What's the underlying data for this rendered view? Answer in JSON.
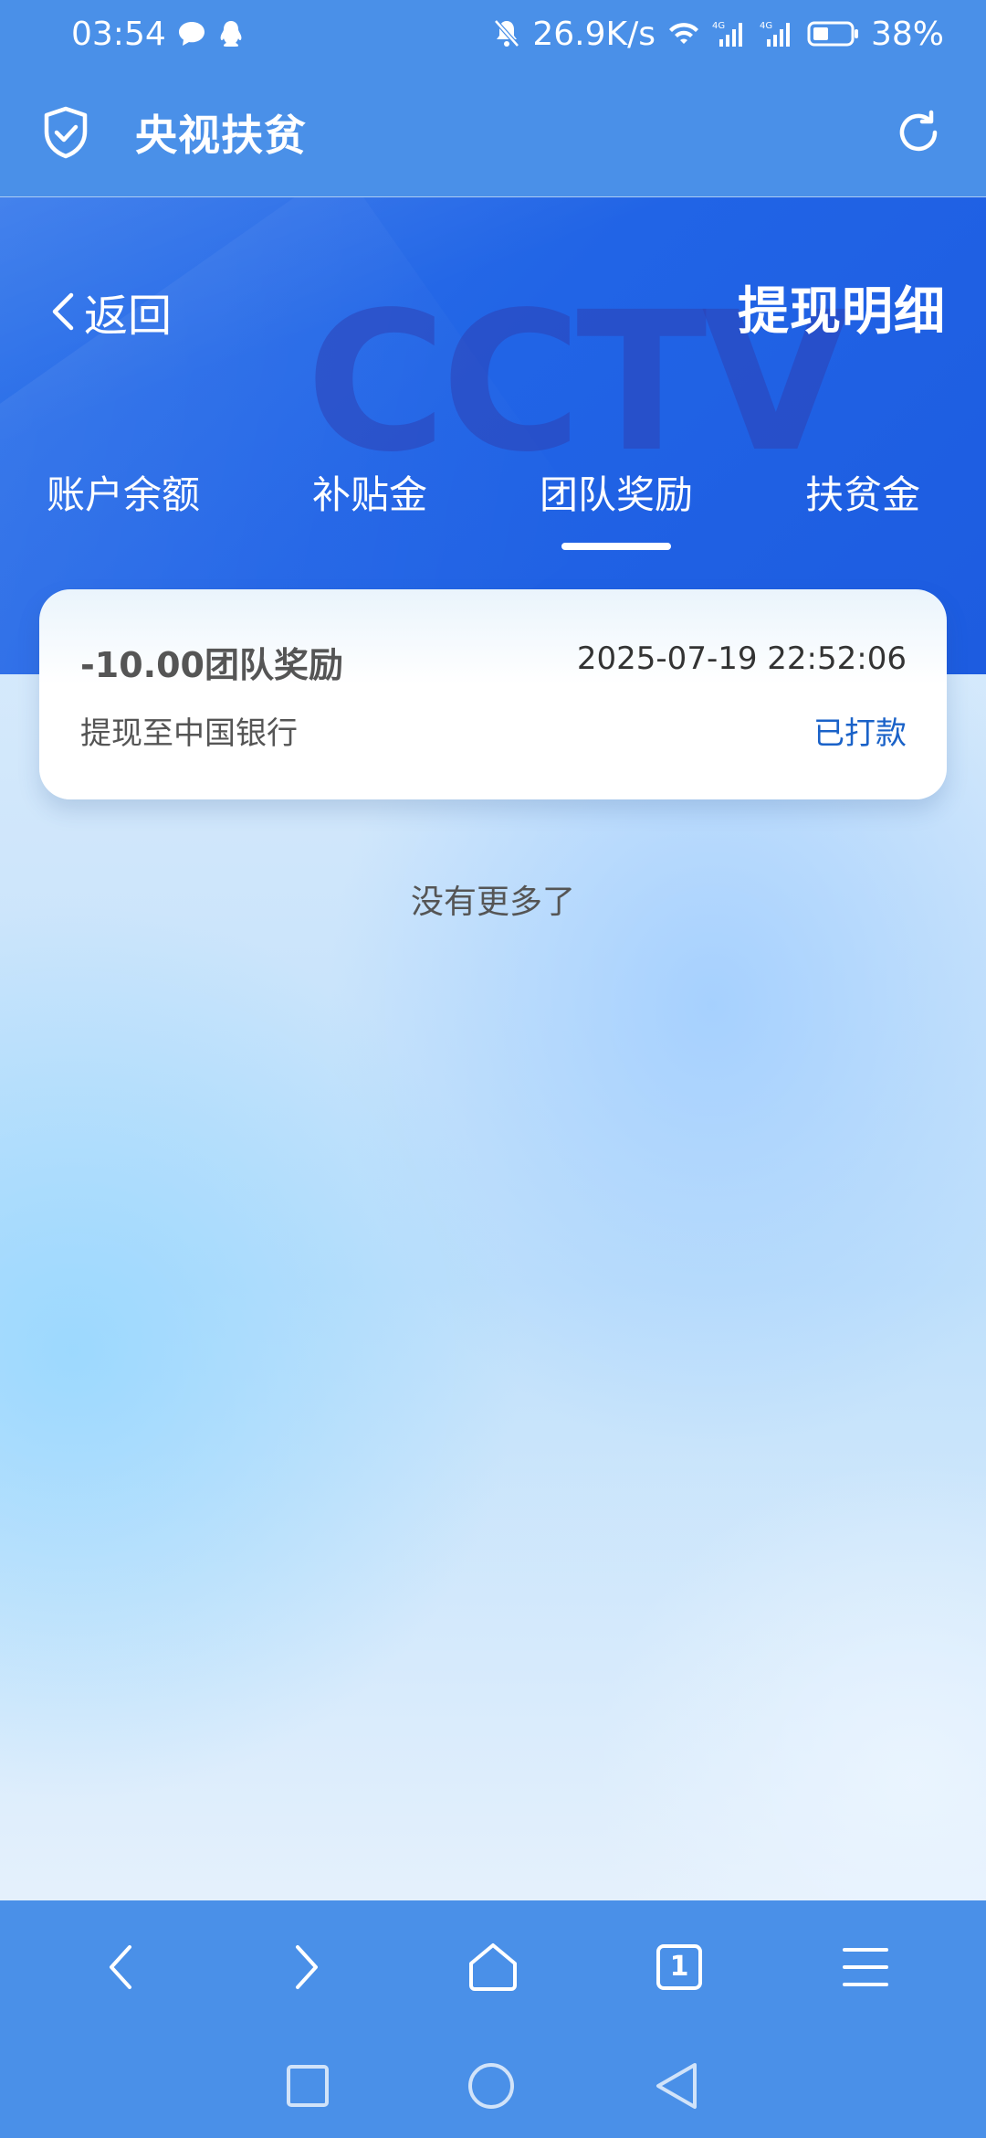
{
  "status_bar": {
    "time": "03:54",
    "network_speed": "26.9K/s",
    "signal1": "4G",
    "signal2": "4G",
    "battery": "38%"
  },
  "app_header": {
    "title": "央视扶贫"
  },
  "hero": {
    "back_label": "返回",
    "page_title": "提现明细",
    "logo_text": "CCTV",
    "tabs": [
      {
        "label": "账户余额",
        "active": false
      },
      {
        "label": "补贴金",
        "active": false
      },
      {
        "label": "团队奖励",
        "active": true
      },
      {
        "label": "扶贫金",
        "active": false
      }
    ]
  },
  "records": [
    {
      "amount": "-10.00团队奖励",
      "time": "2025-07-19 22:52:06",
      "description": "提现至中国银行",
      "status": "已打款"
    }
  ],
  "list_end_text": "没有更多了",
  "browser_nav": {
    "tab_count": "1"
  },
  "colors": {
    "header_blue": "#4a90e8",
    "hero_blue": "#2164e6",
    "status_blue": "#1a62c8"
  }
}
